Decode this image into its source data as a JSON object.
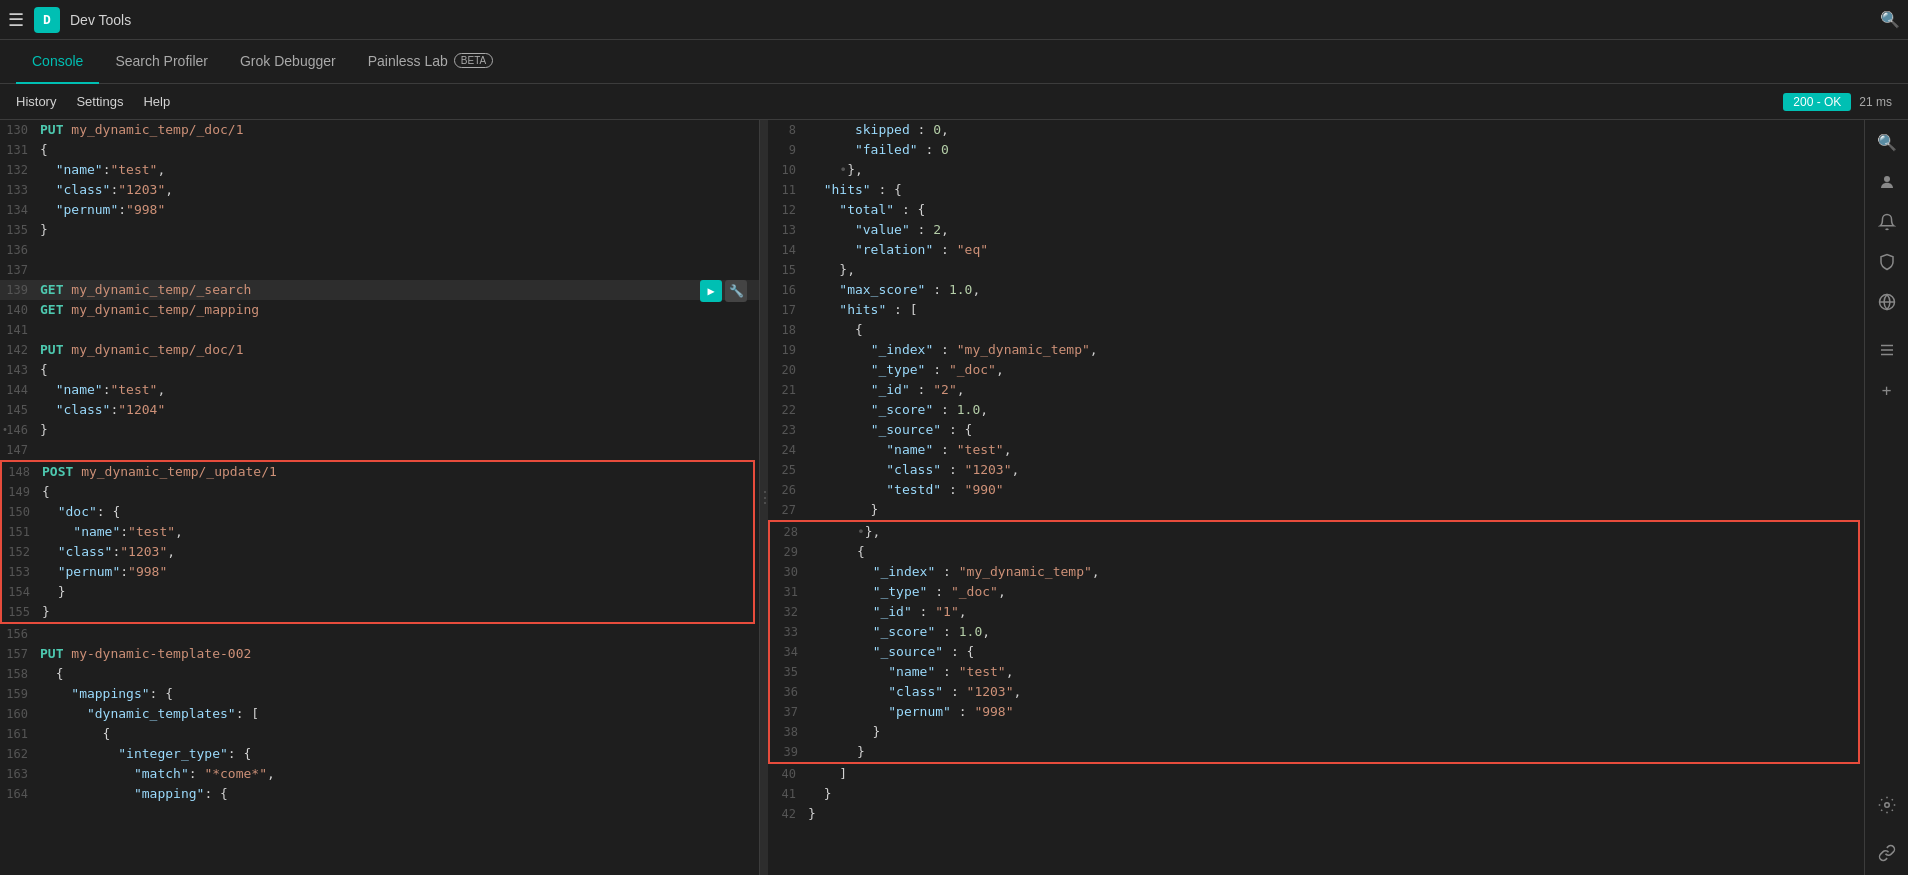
{
  "topbar": {
    "app_icon": "D",
    "app_title": "Dev Tools"
  },
  "tabs": [
    {
      "label": "Console",
      "active": true
    },
    {
      "label": "Search Profiler",
      "active": false
    },
    {
      "label": "Grok Debugger",
      "active": false
    },
    {
      "label": "Painless Lab",
      "active": false,
      "badge": "BETA"
    }
  ],
  "subtoolbar": {
    "history": "History",
    "settings": "Settings",
    "help": "Help",
    "status_code": "200 - OK",
    "response_time": "21 ms"
  },
  "left_code": [
    {
      "num": 130,
      "content": "PUT my_dynamic_temp/_doc/1",
      "type": "request"
    },
    {
      "num": 131,
      "content": "{"
    },
    {
      "num": 132,
      "content": "  \"name\":\"test\","
    },
    {
      "num": 133,
      "content": "  \"class\":\"1203\","
    },
    {
      "num": 134,
      "content": "  \"pernum\":\"998\""
    },
    {
      "num": 135,
      "content": "}"
    },
    {
      "num": 136,
      "content": ""
    },
    {
      "num": 137,
      "content": ""
    },
    {
      "num": 139,
      "content": "GET my_dynamic_temp/_search",
      "type": "request",
      "highlighted": true,
      "has_actions": true
    },
    {
      "num": 140,
      "content": "GET my_dynamic_temp/_mapping",
      "type": "request"
    },
    {
      "num": 141,
      "content": ""
    },
    {
      "num": 142,
      "content": "PUT my_dynamic_temp/_doc/1",
      "type": "request"
    },
    {
      "num": 143,
      "content": "{"
    },
    {
      "num": 144,
      "content": "  \"name\":\"test\","
    },
    {
      "num": 145,
      "content": "  \"class\":\"1204\""
    },
    {
      "num": 146,
      "content": "}"
    },
    {
      "num": 147,
      "content": ""
    },
    {
      "num": 148,
      "content": "POST my_dynamic_temp/_update/1",
      "type": "request",
      "red_box_start": true
    },
    {
      "num": 149,
      "content": "{"
    },
    {
      "num": 150,
      "content": "  \"doc\": {"
    },
    {
      "num": 151,
      "content": "    \"name\":\"test\","
    },
    {
      "num": 152,
      "content": "  \"class\":\"1203\","
    },
    {
      "num": 153,
      "content": "  \"pernum\":\"998\""
    },
    {
      "num": 154,
      "content": "  }"
    },
    {
      "num": 155,
      "content": "}",
      "red_box_end": true
    },
    {
      "num": 156,
      "content": ""
    },
    {
      "num": 157,
      "content": "PUT my-dynamic-template-002",
      "type": "request"
    },
    {
      "num": 158,
      "content": "  {"
    },
    {
      "num": 159,
      "content": "    \"mappings\": {"
    },
    {
      "num": 160,
      "content": "      \"dynamic_templates\": ["
    },
    {
      "num": 161,
      "content": "        {"
    },
    {
      "num": 162,
      "content": "          \"integer_type\": {"
    },
    {
      "num": 163,
      "content": "            \"match\": \"*come*\","
    },
    {
      "num": 164,
      "content": "            \"mapping\": {"
    }
  ],
  "right_code": [
    {
      "num": 8,
      "content": "      skipped : 0,"
    },
    {
      "num": 9,
      "content": "      \"failed\" : 0"
    },
    {
      "num": 10,
      "content": "    },"
    },
    {
      "num": 11,
      "content": "  \"hits\" : {"
    },
    {
      "num": 12,
      "content": "    \"total\" : {"
    },
    {
      "num": 13,
      "content": "      \"value\" : 2,"
    },
    {
      "num": 14,
      "content": "      \"relation\" : \"eq\""
    },
    {
      "num": 15,
      "content": "    },"
    },
    {
      "num": 16,
      "content": "    \"max_score\" : 1.0,"
    },
    {
      "num": 17,
      "content": "    \"hits\" : ["
    },
    {
      "num": 18,
      "content": "      {"
    },
    {
      "num": 19,
      "content": "        \"_index\" : \"my_dynamic_temp\","
    },
    {
      "num": 20,
      "content": "        \"_type\" : \"_doc\","
    },
    {
      "num": 21,
      "content": "        \"_id\" : \"2\","
    },
    {
      "num": 22,
      "content": "        \"_score\" : 1.0,"
    },
    {
      "num": 23,
      "content": "        \"_source\" : {"
    },
    {
      "num": 24,
      "content": "          \"name\" : \"test\","
    },
    {
      "num": 25,
      "content": "          \"class\" : \"1203\","
    },
    {
      "num": 26,
      "content": "          \"testd\" : \"990\""
    },
    {
      "num": 27,
      "content": "        }"
    },
    {
      "num": 28,
      "content": "      },",
      "red_box_start": true
    },
    {
      "num": 29,
      "content": "      {"
    },
    {
      "num": 30,
      "content": "        \"_index\" : \"my_dynamic_temp\","
    },
    {
      "num": 31,
      "content": "        \"_type\" : \"_doc\","
    },
    {
      "num": 32,
      "content": "        \"_id\" : \"1\","
    },
    {
      "num": 33,
      "content": "        \"_score\" : 1.0,"
    },
    {
      "num": 34,
      "content": "        \"_source\" : {"
    },
    {
      "num": 35,
      "content": "          \"name\" : \"test\","
    },
    {
      "num": 36,
      "content": "          \"class\" : \"1203\","
    },
    {
      "num": 37,
      "content": "          \"pernum\" : \"998\""
    },
    {
      "num": 38,
      "content": "        }"
    },
    {
      "num": 39,
      "content": "      }",
      "red_box_end": true
    },
    {
      "num": 40,
      "content": "    ]"
    },
    {
      "num": 41,
      "content": "  }"
    },
    {
      "num": 42,
      "content": "}"
    }
  ],
  "side_icons": [
    {
      "name": "search",
      "symbol": "🔍",
      "active": false
    },
    {
      "name": "user",
      "symbol": "👤",
      "active": false
    },
    {
      "name": "cog",
      "symbol": "⚙",
      "active": false
    },
    {
      "name": "circle",
      "symbol": "●",
      "active": false
    },
    {
      "name": "outlook",
      "symbol": "◉",
      "active": false
    },
    {
      "name": "map",
      "symbol": "◈",
      "active": false
    },
    {
      "name": "puzzle",
      "symbol": "✦",
      "active": false
    },
    {
      "name": "plus",
      "symbol": "+",
      "active": false
    },
    {
      "name": "settings2",
      "symbol": "⊞",
      "active": false
    },
    {
      "name": "link",
      "symbol": "⎘",
      "active": false
    }
  ]
}
